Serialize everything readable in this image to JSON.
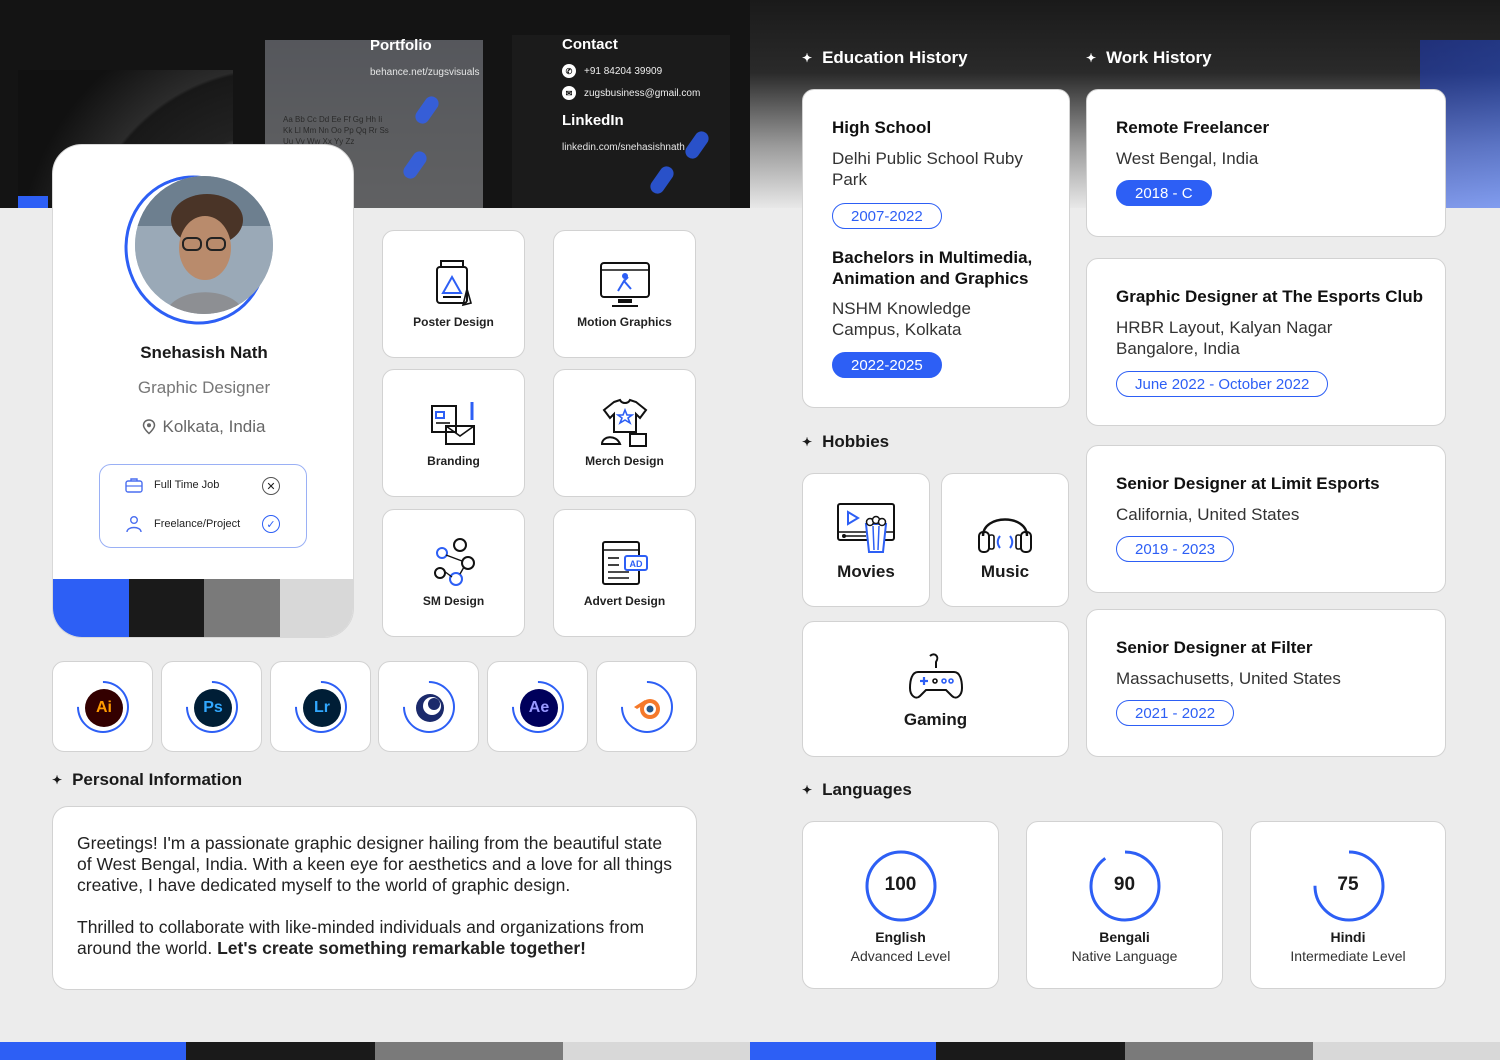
{
  "header": {
    "portfolio_title": "Portfolio",
    "portfolio_url": "behance.net/zugsvisuals",
    "contact_title": "Contact",
    "phone": "+91 84204  39909",
    "email": "zugsbusiness@gmail.com",
    "linkedin_title": "LinkedIn",
    "linkedin_url": "linkedin.com/snehasishnath",
    "paper_text_1": "Aa Bb Cc Dd Ee Ff Gg Hh Ii",
    "paper_text_2": "Kk Ll Mm Nn Oo Pp Qq Rr Ss",
    "paper_text_3": "Uu Vv Ww Xx Yy Zz"
  },
  "profile": {
    "name": "Snehasish Nath",
    "role": "Graphic Designer",
    "location": "Kolkata, India",
    "job_types": [
      {
        "label": "Full Time Job",
        "status": "declined"
      },
      {
        "label": "Freelance/Project",
        "status": "accepted"
      }
    ],
    "swatches": [
      "#2d5ff5",
      "#1a1a1a",
      "#7a7a7a",
      "#d8d8d8"
    ]
  },
  "skills": [
    {
      "label": "Poster Design",
      "icon": "poster-icon"
    },
    {
      "label": "Motion Graphics",
      "icon": "motion-graphics-icon"
    },
    {
      "label": "Branding",
      "icon": "branding-icon"
    },
    {
      "label": "Merch Design",
      "icon": "merch-icon"
    },
    {
      "label": "SM Design",
      "icon": "social-media-icon"
    },
    {
      "label": "Advert Design",
      "icon": "advert-icon"
    }
  ],
  "software": [
    {
      "abbr": "Ai",
      "name": "illustrator-icon",
      "bg": "#330000",
      "fg": "#ff9a00"
    },
    {
      "abbr": "Ps",
      "name": "photoshop-icon",
      "bg": "#001e36",
      "fg": "#31a8ff"
    },
    {
      "abbr": "Lr",
      "name": "lightroom-icon",
      "bg": "#001e36",
      "fg": "#31a8ff"
    },
    {
      "abbr": "",
      "name": "cinema4d-icon",
      "bg": "#0a1a4a",
      "fg": "#ffffff"
    },
    {
      "abbr": "Ae",
      "name": "after-effects-icon",
      "bg": "#00005b",
      "fg": "#9999ff"
    },
    {
      "abbr": "",
      "name": "blender-icon",
      "bg": "#ffffff",
      "fg": "#f5792a"
    }
  ],
  "personal": {
    "heading": "Personal Information",
    "para1": "Greetings! I'm a passionate graphic designer hailing from the beautiful state of West Bengal, India. With a keen eye for aesthetics and a love for all things creative, I have dedicated myself to the world of graphic design.",
    "para2_plain": "Thrilled to collaborate with like-minded individuals and organizations from around the world. ",
    "para2_bold": "Let's create something remarkable together!"
  },
  "education": {
    "heading": "Education History",
    "items": [
      {
        "title": "High School",
        "place": "Delhi Public School Ruby Park",
        "years": "2007-2022"
      },
      {
        "title": "Bachelors in Multimedia, Animation and Graphics",
        "place": "NSHM Knowledge Campus, Kolkata",
        "years": "2022-2025"
      }
    ]
  },
  "work": {
    "heading": "Work History",
    "items": [
      {
        "title": "Remote Freelancer",
        "place": "West Bengal, India",
        "years": "2018 - C"
      },
      {
        "title": "Graphic Designer at The Esports Club",
        "place": "HRBR Layout, Kalyan Nagar Bangalore, India",
        "years": "June 2022 - October 2022"
      },
      {
        "title": "Senior Designer at Limit Esports",
        "place": "California, United States",
        "years": "2019 - 2023"
      },
      {
        "title": "Senior Designer at Filter",
        "place": "Massachusetts, United States",
        "years": "2021 - 2022"
      }
    ]
  },
  "hobbies": {
    "heading": "Hobbies",
    "items": [
      {
        "label": "Movies",
        "icon": "movies-icon"
      },
      {
        "label": "Music",
        "icon": "headphones-icon"
      },
      {
        "label": "Gaming",
        "icon": "gamepad-icon"
      }
    ]
  },
  "languages": {
    "heading": "Languages",
    "items": [
      {
        "score": "100",
        "value": 100,
        "name": "English",
        "level": "Advanced Level"
      },
      {
        "score": "90",
        "value": 90,
        "name": "Bengali",
        "level": "Native Language"
      },
      {
        "score": "75",
        "value": 75,
        "name": "Hindi",
        "level": "Intermediate Level"
      }
    ]
  },
  "colors": {
    "accent": "#2d5ff5",
    "dark": "#1a1a1a",
    "gray": "#7a7a7a",
    "light": "#d8d8d8"
  }
}
